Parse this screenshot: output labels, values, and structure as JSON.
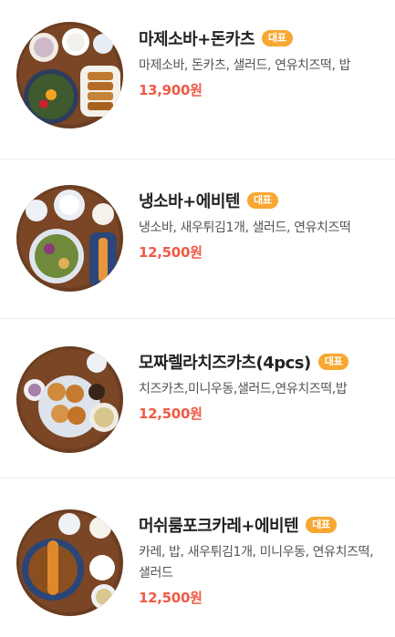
{
  "colors": {
    "badge": "#f7a732",
    "price": "#f05a46",
    "title": "#222222",
    "description": "#555555"
  },
  "items": [
    {
      "name": "마제소바+돈카츠",
      "badge": "대표",
      "description": "마제소바, 돈카츠, 샐러드, 연유치즈떡, 밥",
      "price": "13,900원"
    },
    {
      "name": "냉소바+에비텐",
      "badge": "대표",
      "description": "냉소바, 새우튀김1개, 샐러드, 연유치즈떡",
      "price": "12,500원"
    },
    {
      "name": "모짜렐라치즈카츠(4pcs)",
      "badge": "대표",
      "description": "치즈카츠,미니우동,샐러드,연유치즈떡,밥",
      "price": "12,500원"
    },
    {
      "name": "머쉬룸포크카레+에비텐",
      "badge": "대표",
      "description": "카레, 밥, 새우튀김1개, 미니우동, 연유치즈떡, 샐러드",
      "price": "12,500원"
    }
  ]
}
